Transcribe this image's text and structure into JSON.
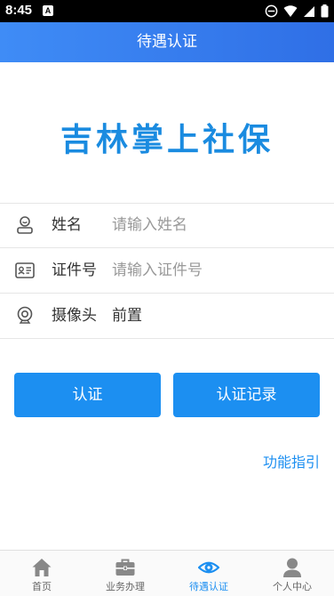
{
  "status_bar": {
    "time": "8:45",
    "a_badge": "A"
  },
  "header": {
    "title": "待遇认证"
  },
  "logo": {
    "text": "吉林掌上社保"
  },
  "form": {
    "name": {
      "label": "姓名",
      "placeholder": "请输入姓名",
      "value": ""
    },
    "id_number": {
      "label": "证件号",
      "placeholder": "请输入证件号",
      "value": ""
    },
    "camera": {
      "label": "摄像头",
      "value": "前置"
    }
  },
  "buttons": {
    "verify": "认证",
    "records": "认证记录"
  },
  "guide_link": "功能指引",
  "tabbar": {
    "items": [
      {
        "label": "首页",
        "icon": "home-icon",
        "active": false
      },
      {
        "label": "业务办理",
        "icon": "briefcase-icon",
        "active": false
      },
      {
        "label": "待遇认证",
        "icon": "eye-icon",
        "active": true
      },
      {
        "label": "个人中心",
        "icon": "person-icon",
        "active": false
      }
    ]
  },
  "colors": {
    "primary": "#1c8ff1",
    "header_start": "#3f8cf6",
    "header_end": "#2f6fe6",
    "tab_inactive": "#888888"
  }
}
